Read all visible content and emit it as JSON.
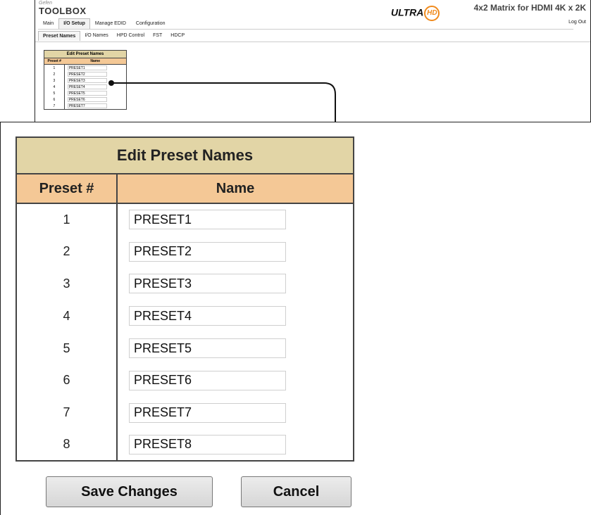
{
  "header": {
    "brand_small": "Gefen",
    "brand": "TOOLBOX",
    "ultra": "ULTRA",
    "hd": "HD",
    "product": "4x2 Matrix for HDMI 4K x 2K",
    "logout": "Log Out"
  },
  "main_tabs": [
    "Main",
    "I/O Setup",
    "Manage EDID",
    "Configuration"
  ],
  "sub_tabs": [
    "Preset Names",
    "I/O Names",
    "HPD Control",
    "FST",
    "HDCP"
  ],
  "table": {
    "title": "Edit Preset Names",
    "col_num": "Preset #",
    "col_name": "Name",
    "rows": [
      {
        "num": "1",
        "name": "PRESET1"
      },
      {
        "num": "2",
        "name": "PRESET2"
      },
      {
        "num": "3",
        "name": "PRESET3"
      },
      {
        "num": "4",
        "name": "PRESET4"
      },
      {
        "num": "5",
        "name": "PRESET5"
      },
      {
        "num": "6",
        "name": "PRESET6"
      },
      {
        "num": "7",
        "name": "PRESET7"
      },
      {
        "num": "8",
        "name": "PRESET8"
      }
    ]
  },
  "buttons": {
    "save": "Save Changes",
    "cancel": "Cancel"
  },
  "colors": {
    "title_bg": "#e2d5a6",
    "header_bg": "#f4c896",
    "hd_accent": "#f08a1c"
  }
}
